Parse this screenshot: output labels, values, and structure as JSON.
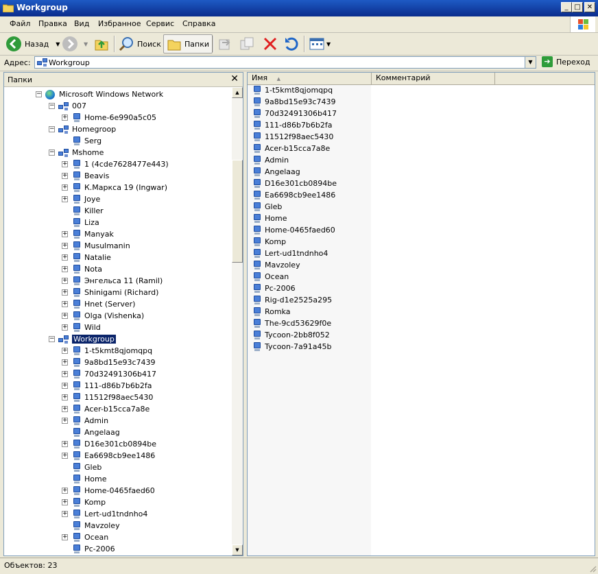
{
  "window": {
    "title": "Workgroup"
  },
  "menu": [
    "Файл",
    "Правка",
    "Вид",
    "Избранное",
    "Сервис",
    "Справка"
  ],
  "toolbar": {
    "back": "Назад",
    "search": "Поиск",
    "folders": "Папки"
  },
  "address": {
    "label": "Адрес:",
    "value": "Workgroup",
    "go": "Переход"
  },
  "folders_pane": {
    "title": "Папки"
  },
  "tree": [
    {
      "label": "Microsoft Windows Network",
      "type": "globe",
      "level": 0,
      "expander": "minus"
    },
    {
      "label": "007",
      "type": "net",
      "level": 1,
      "expander": "minus"
    },
    {
      "label": "Home-6e990a5c05",
      "type": "pc",
      "level": 2,
      "expander": "plus"
    },
    {
      "label": "Homegroop",
      "type": "net",
      "level": 1,
      "expander": "minus"
    },
    {
      "label": "Serg",
      "type": "pc",
      "level": 2,
      "expander": "none"
    },
    {
      "label": "Mshome",
      "type": "net",
      "level": 1,
      "expander": "minus"
    },
    {
      "label": "1 (4cde7628477e443)",
      "type": "pc",
      "level": 2,
      "expander": "plus"
    },
    {
      "label": "Beavis",
      "type": "pc",
      "level": 2,
      "expander": "plus"
    },
    {
      "label": "К.Маркса 19 (Ingwar)",
      "type": "pc",
      "level": 2,
      "expander": "plus"
    },
    {
      "label": "Joye",
      "type": "pc",
      "level": 2,
      "expander": "plus"
    },
    {
      "label": "Killer",
      "type": "pc",
      "level": 2,
      "expander": "none"
    },
    {
      "label": "Liza",
      "type": "pc",
      "level": 2,
      "expander": "none"
    },
    {
      "label": "Manyak",
      "type": "pc",
      "level": 2,
      "expander": "plus"
    },
    {
      "label": "Musulmanin",
      "type": "pc",
      "level": 2,
      "expander": "plus"
    },
    {
      "label": "Natalie",
      "type": "pc",
      "level": 2,
      "expander": "plus"
    },
    {
      "label": "Nota",
      "type": "pc",
      "level": 2,
      "expander": "plus"
    },
    {
      "label": "Энгельса 11 (Ramil)",
      "type": "pc",
      "level": 2,
      "expander": "plus"
    },
    {
      "label": "Shinigami (Richard)",
      "type": "pc",
      "level": 2,
      "expander": "plus"
    },
    {
      "label": "Hnet (Server)",
      "type": "pc",
      "level": 2,
      "expander": "plus"
    },
    {
      "label": "Olga (Vishenka)",
      "type": "pc",
      "level": 2,
      "expander": "plus"
    },
    {
      "label": "Wild",
      "type": "pc",
      "level": 2,
      "expander": "plus"
    },
    {
      "label": "Workgroup",
      "type": "net",
      "level": 1,
      "expander": "minus",
      "selected": true
    },
    {
      "label": "1-t5kmt8qjomqpq",
      "type": "pc",
      "level": 2,
      "expander": "plus"
    },
    {
      "label": "9a8bd15e93c7439",
      "type": "pc",
      "level": 2,
      "expander": "plus"
    },
    {
      "label": "70d32491306b417",
      "type": "pc",
      "level": 2,
      "expander": "plus"
    },
    {
      "label": "111-d86b7b6b2fa",
      "type": "pc",
      "level": 2,
      "expander": "plus"
    },
    {
      "label": "11512f98aec5430",
      "type": "pc",
      "level": 2,
      "expander": "plus"
    },
    {
      "label": "Acer-b15cca7a8e",
      "type": "pc",
      "level": 2,
      "expander": "plus"
    },
    {
      "label": "Admin",
      "type": "pc",
      "level": 2,
      "expander": "plus"
    },
    {
      "label": "Angelaag",
      "type": "pc",
      "level": 2,
      "expander": "none"
    },
    {
      "label": "D16e301cb0894be",
      "type": "pc",
      "level": 2,
      "expander": "plus"
    },
    {
      "label": "Ea6698cb9ee1486",
      "type": "pc",
      "level": 2,
      "expander": "plus"
    },
    {
      "label": "Gleb",
      "type": "pc",
      "level": 2,
      "expander": "none"
    },
    {
      "label": "Home",
      "type": "pc",
      "level": 2,
      "expander": "none"
    },
    {
      "label": "Home-0465faed60",
      "type": "pc",
      "level": 2,
      "expander": "plus"
    },
    {
      "label": "Komp",
      "type": "pc",
      "level": 2,
      "expander": "plus"
    },
    {
      "label": "Lert-ud1tndnho4",
      "type": "pc",
      "level": 2,
      "expander": "plus"
    },
    {
      "label": "Mavzoley",
      "type": "pc",
      "level": 2,
      "expander": "none"
    },
    {
      "label": "Ocean",
      "type": "pc",
      "level": 2,
      "expander": "plus"
    },
    {
      "label": "Pc-2006",
      "type": "pc",
      "level": 2,
      "expander": "none"
    }
  ],
  "list": {
    "columns": [
      "Имя",
      "Комментарий"
    ],
    "items": [
      "1-t5kmt8qjomqpq",
      "9a8bd15e93c7439",
      "70d32491306b417",
      "111-d86b7b6b2fa",
      "11512f98aec5430",
      "Acer-b15cca7a8e",
      "Admin",
      "Angelaag",
      "D16e301cb0894be",
      "Ea6698cb9ee1486",
      "Gleb",
      "Home",
      "Home-0465faed60",
      "Komp",
      "Lert-ud1tndnho4",
      "Mavzoley",
      "Ocean",
      "Pc-2006",
      "Rig-d1e2525a295",
      "Romka",
      "The-9cd53629f0e",
      "Tycoon-2bb8f052",
      "Tycoon-7a91a45b"
    ]
  },
  "status": {
    "text": "Объектов: 23"
  },
  "colors": {
    "titlebar": "#0a2c8c",
    "selection": "#0a246a",
    "chrome": "#ece9d8"
  }
}
